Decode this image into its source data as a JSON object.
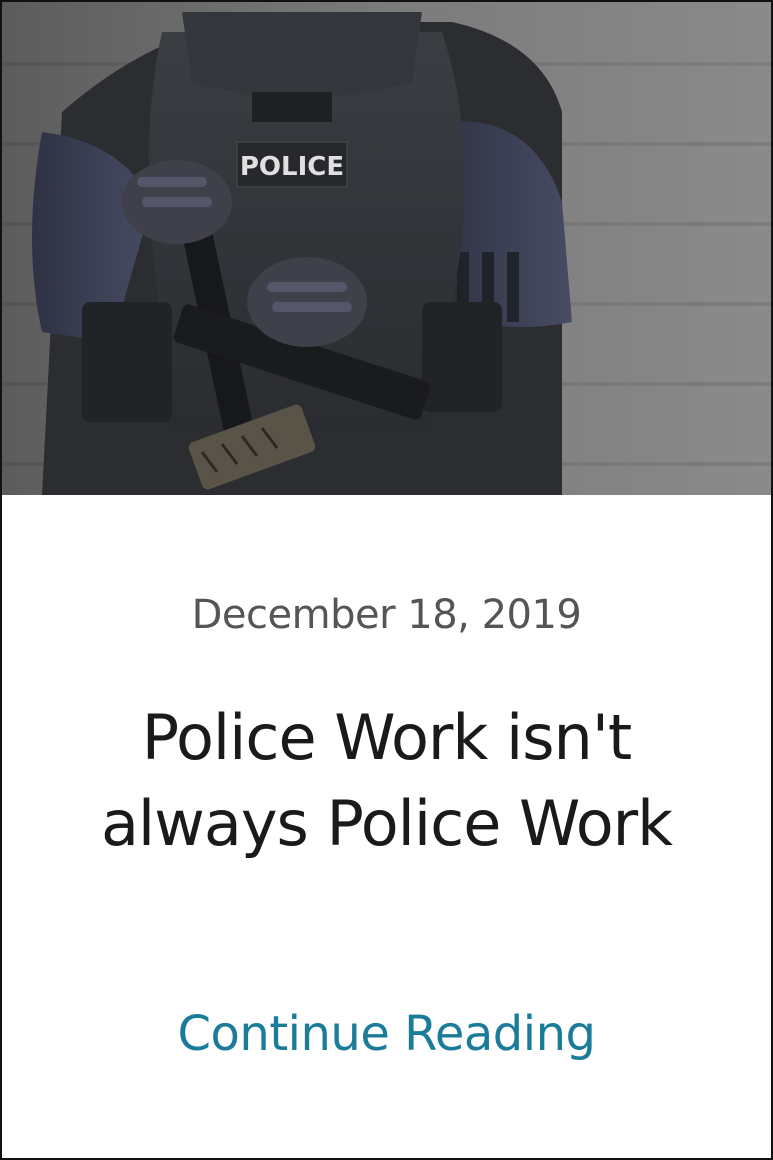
{
  "post": {
    "image_alt": "Armored police officer holding rifle",
    "image_patch_text": "POLICE",
    "date": "December 18, 2019",
    "title": "Police Work isn't always Police Work",
    "link_label": "Continue Reading"
  },
  "colors": {
    "link": "#1b7c9a",
    "title": "#1a1a1a",
    "date": "#555555",
    "border": "#111111"
  }
}
